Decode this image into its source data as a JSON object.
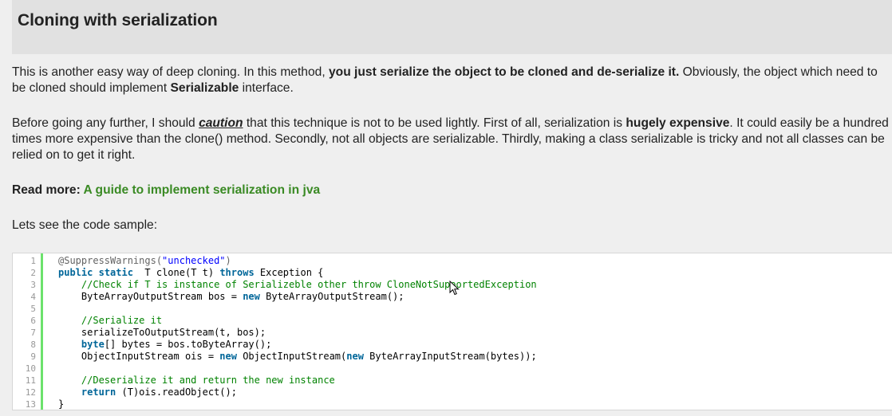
{
  "section": {
    "title": "Cloning with serialization"
  },
  "paragraph1": {
    "text_a": "This is another easy way of deep cloning. In this method, ",
    "bold_a": "you just serialize the object to be cloned and de-serialize it.",
    "text_b": " Obviously, the object which need to be cloned should implement ",
    "bold_b": "Serializable",
    "text_c": " interface."
  },
  "paragraph2": {
    "text_a": "Before going any further, I should ",
    "caution": "caution",
    "text_b": " that this technique is not to be used lightly. First of all, serialization is ",
    "bold_a": "hugely expensive",
    "text_c": ". It could easily be a hundred times more expensive than the clone() method. Secondly, not all objects are serializable. Thirdly, making a class serializable is tricky and not all classes can be relied on to get it right."
  },
  "read_more": {
    "label": "Read more: ",
    "link_text": "A guide to implement serialization in jva"
  },
  "lead_in": "Lets see the code sample:",
  "code": {
    "line_numbers": [
      "1",
      "2",
      "3",
      "4",
      "5",
      "6",
      "7",
      "8",
      "9",
      "10",
      "11",
      "12",
      "13"
    ],
    "lines": {
      "l1_annotation": "@SuppressWarnings(",
      "l1_string": "\"unchecked\"",
      "l1_close": ")",
      "l2_kw1": "public",
      "l2_kw2": "static",
      "l2_mid": "  T clone(T t) ",
      "l2_kw3": "throws",
      "l2_end": " Exception {",
      "l3_comment": "    //Check if T is instance of Serializeble other throw CloneNotSupportedException",
      "l4_a": "    ByteArrayOutputStream bos = ",
      "l4_kw": "new",
      "l4_b": " ByteArrayOutputStream();",
      "l6_comment": "    //Serialize it",
      "l7": "    serializeToOutputStream(t, bos);",
      "l8_indent": "    ",
      "l8_kw": "byte",
      "l8_rest": "[] bytes = bos.toByteArray();",
      "l9_a": "    ObjectInputStream ois = ",
      "l9_kw1": "new",
      "l9_b": " ObjectInputStream(",
      "l9_kw2": "new",
      "l9_c": " ByteArrayInputStream(bytes));",
      "l11_comment": "    //Deserialize it and return the new instance",
      "l12_indent": "    ",
      "l12_kw": "return",
      "l12_rest": " (T)ois.readObject();",
      "l13": "}"
    }
  },
  "colors": {
    "background": "#efefef",
    "heading_bar": "#e1e1e1",
    "link": "#3a8a24",
    "keyword": "#006699",
    "comment": "#008200",
    "string": "#0000ff",
    "gutter_border": "#6ce26c"
  }
}
